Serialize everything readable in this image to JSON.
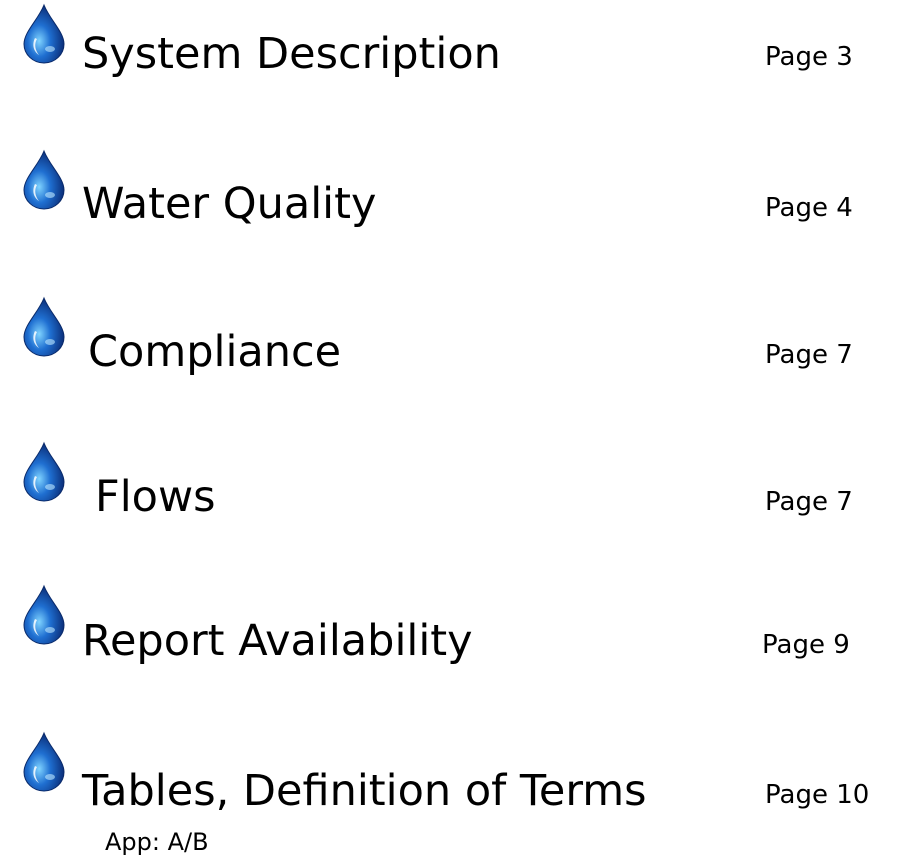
{
  "toc": {
    "icon": "water-drop-icon",
    "accent": "#1f6fd1",
    "entries": [
      {
        "title": "System Description",
        "page": "Page 3"
      },
      {
        "title": "Water Quality",
        "page": "Page 4"
      },
      {
        "title": "Compliance",
        "page": "Page 7"
      },
      {
        "title": "Flows",
        "page": "Page  7"
      },
      {
        "title": "Report Availability",
        "page": "Page 9"
      },
      {
        "title": "Tables, Definition of Terms",
        "page": "Page 10",
        "subtitle": "App: A/B"
      }
    ]
  }
}
